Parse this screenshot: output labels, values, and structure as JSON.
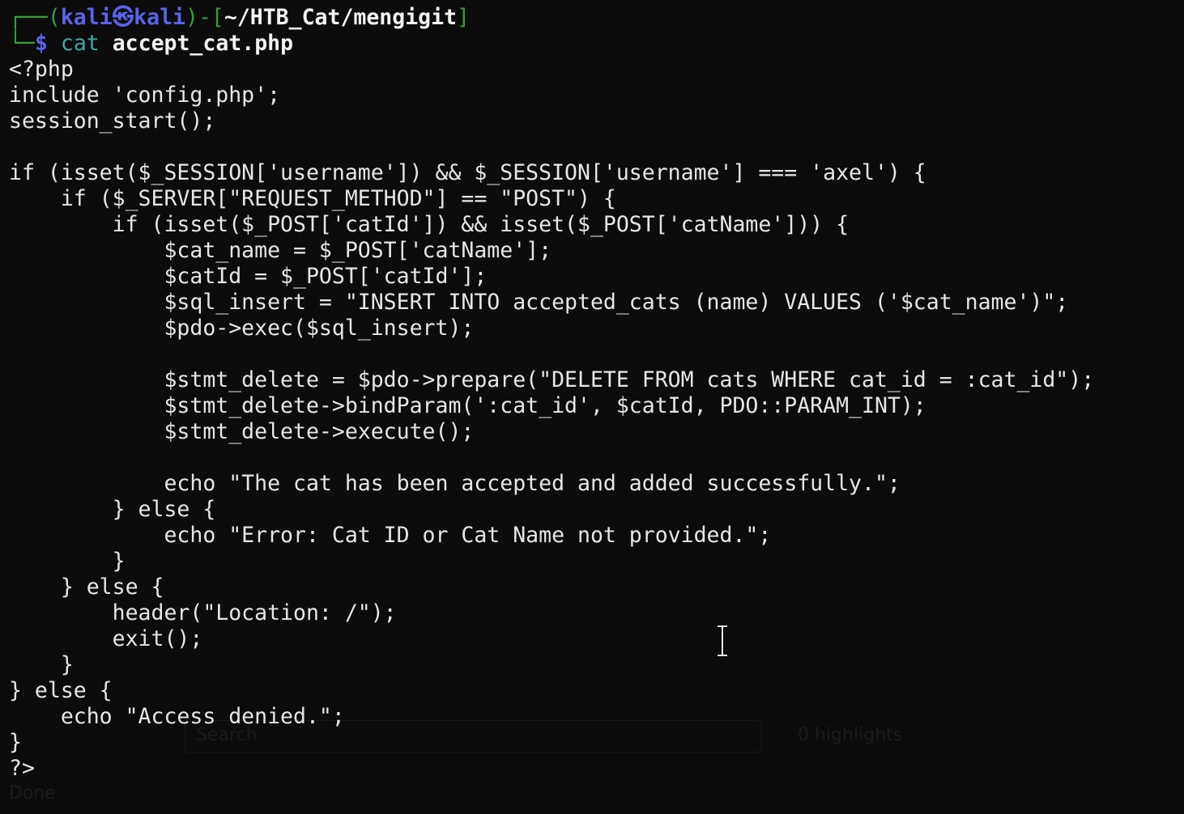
{
  "terminal": {
    "prompt": {
      "box_top": "┌──(",
      "user": "kali",
      "at": "㉿",
      "host": "kali",
      "sep": ")-[",
      "path": "~/HTB_Cat/mengigit",
      "close": "]",
      "box_bottom": "└─",
      "dollar": "$",
      "command": "cat",
      "argument": "accept_cat.php"
    },
    "output_lines": [
      "<?php",
      "include 'config.php';",
      "session_start();",
      "",
      "if (isset($_SESSION['username']) && $_SESSION['username'] === 'axel') {",
      "    if ($_SERVER[\"REQUEST_METHOD\"] == \"POST\") {",
      "        if (isset($_POST['catId']) && isset($_POST['catName'])) {",
      "            $cat_name = $_POST['catName'];",
      "            $catId = $_POST['catId'];",
      "            $sql_insert = \"INSERT INTO accepted_cats (name) VALUES ('$cat_name')\";",
      "            $pdo->exec($sql_insert);",
      "",
      "            $stmt_delete = $pdo->prepare(\"DELETE FROM cats WHERE cat_id = :cat_id\");",
      "            $stmt_delete->bindParam(':cat_id', $catId, PDO::PARAM_INT);",
      "            $stmt_delete->execute();",
      "",
      "            echo \"The cat has been accepted and added successfully.\";",
      "        } else {",
      "            echo \"Error: Cat ID or Cat Name not provided.\";",
      "        }",
      "    } else {",
      "        header(\"Location: /\");",
      "        exit();",
      "    }",
      "} else {",
      "    echo \"Access denied.\";",
      "}",
      "?>"
    ]
  },
  "background_window": {
    "search_placeholder": "Search",
    "highlights": "0 highlights",
    "status": "Done"
  },
  "colors": {
    "background": "#0c0c0c",
    "prompt_box": "#3c9a3c",
    "prompt_user": "#5a63ea",
    "command": "#3fa6a6",
    "text": "#e6e6e6"
  }
}
